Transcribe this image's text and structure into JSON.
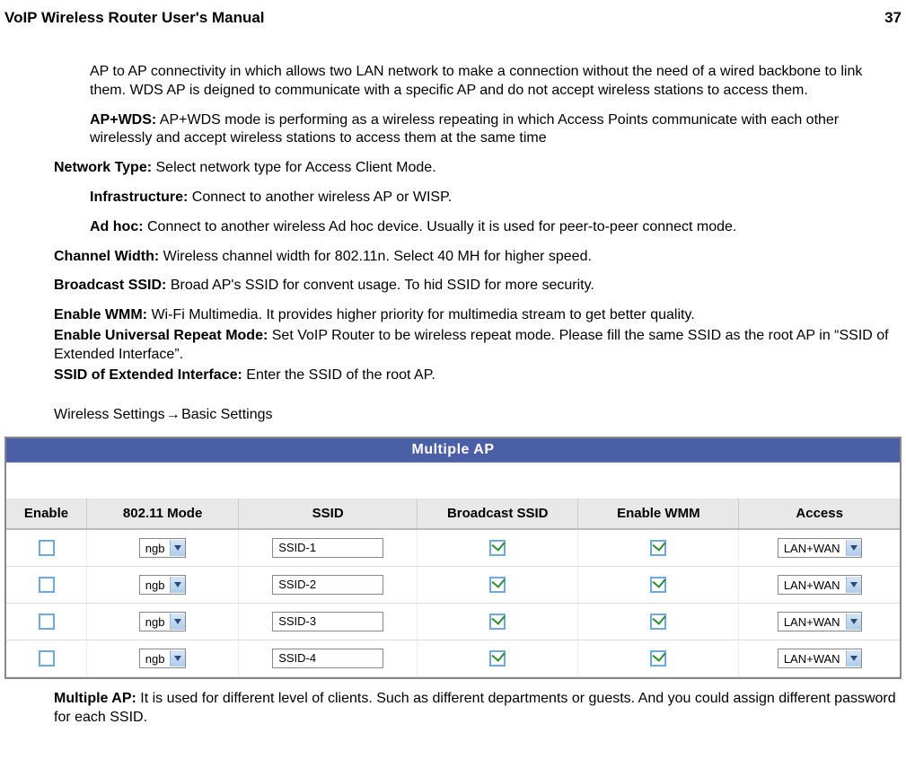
{
  "header": {
    "title": "VoIP Wireless Router User's Manual",
    "page": "37"
  },
  "paragraphs": {
    "ap_to_ap": "AP to AP connectivity in which allows two LAN network to make a connection without the need of a wired backbone to link them. WDS AP is deigned to communicate with a specific AP and do not accept wireless stations to access them.",
    "ap_wds_label": "AP+WDS:",
    "ap_wds_text": " AP+WDS mode is performing as a wireless repeating in which Access Points communicate with each other wirelessly and accept wireless stations to access them at the same time",
    "network_type_label": "Network Type:",
    "network_type_text": " Select network type for Access Client Mode.",
    "infra_label": "Infrastructure:",
    "infra_text": " Connect to another wireless AP or WISP.",
    "adhoc_label": "Ad hoc:",
    "adhoc_text": " Connect to another wireless Ad hoc device. Usually it is used for peer-to-peer connect mode.",
    "chwidth_label": "Channel Width:",
    "chwidth_text": " Wireless channel width for 802.11n. Select 40 MH for higher speed.",
    "bssid_label": "Broadcast SSID:",
    "bssid_text": " Broad AP's SSID for convent usage. To hid SSID for more security.",
    "wmm_label": "Enable WMM:",
    "wmm_text": " Wi-Fi Multimedia. It provides higher priority for multimedia stream to get better quality.",
    "urm_label": "Enable Universal Repeat Mode:",
    "urm_text": " Set VoIP Router to be wireless repeat mode. Please fill the same SSID as the root AP in “SSID of Extended Interface”.",
    "ssid_ext_label": "SSID of Extended Interface:",
    "ssid_ext_text": " Enter the SSID of the root AP.",
    "breadcrumb_a": "Wireless Settings ",
    "breadcrumb_arrow": "→",
    "breadcrumb_b": " Basic Settings",
    "multiple_ap_label": "Multiple AP:",
    "multiple_ap_text": " It is used for different level of clients. Such as different departments or guests. And you could assign different password for each SSID."
  },
  "table": {
    "title": "Multiple AP",
    "headers": {
      "enable": "Enable",
      "mode": "802.11 Mode",
      "ssid": "SSID",
      "broadcast": "Broadcast SSID",
      "wmm": "Enable WMM",
      "access": "Access"
    },
    "rows": [
      {
        "mode": "ngb",
        "ssid": "SSID-1",
        "access": "LAN+WAN"
      },
      {
        "mode": "ngb",
        "ssid": "SSID-2",
        "access": "LAN+WAN"
      },
      {
        "mode": "ngb",
        "ssid": "SSID-3",
        "access": "LAN+WAN"
      },
      {
        "mode": "ngb",
        "ssid": "SSID-4",
        "access": "LAN+WAN"
      }
    ]
  }
}
